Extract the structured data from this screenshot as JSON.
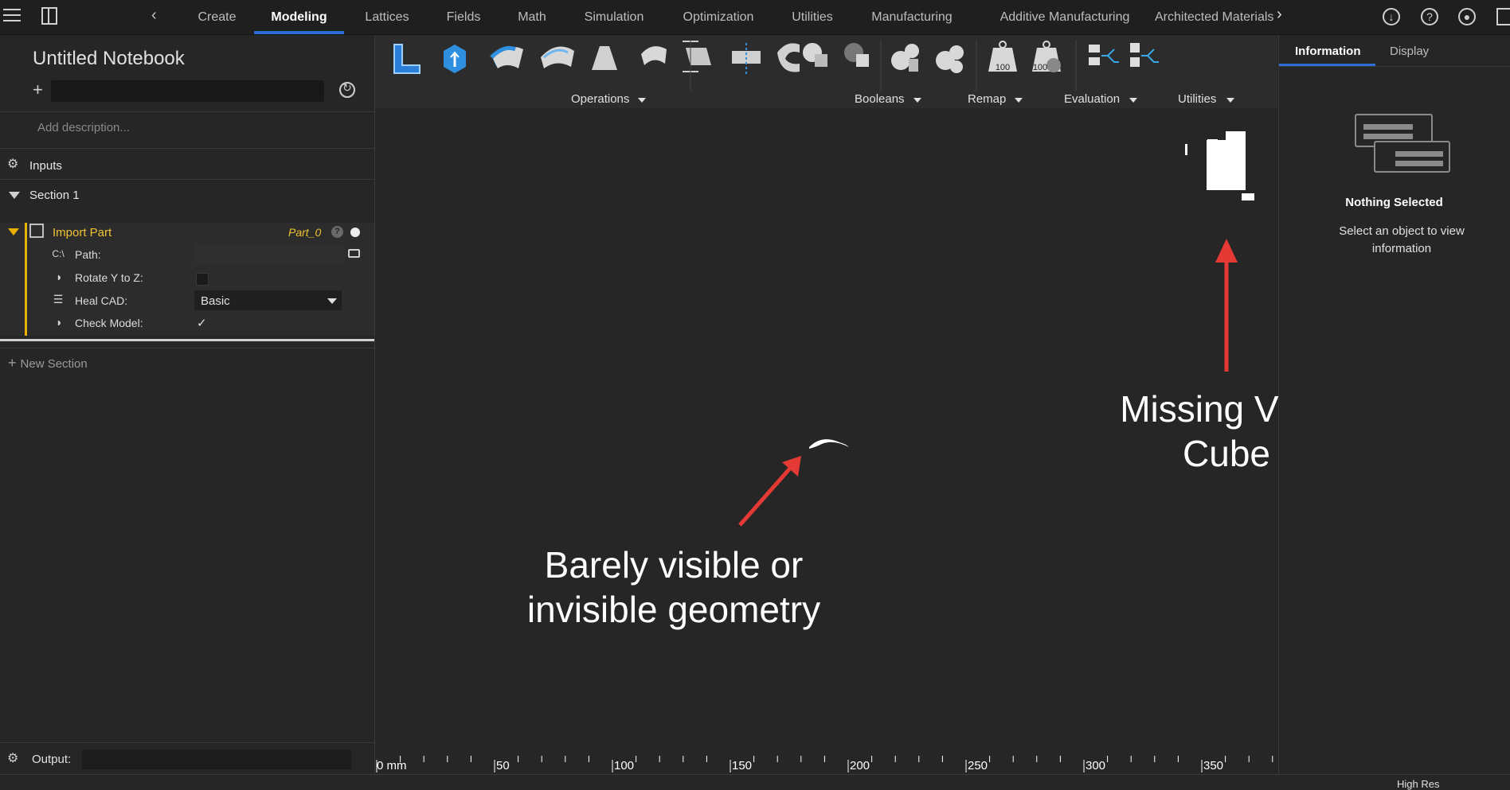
{
  "topbar": {
    "tabs": [
      "Create",
      "Modeling",
      "Lattices",
      "Fields",
      "Math",
      "Simulation",
      "Optimization",
      "Utilities",
      "Manufacturing",
      "Additive Manufacturing",
      "Architected Materials"
    ],
    "active_tab": "Modeling",
    "accent": "#2a6fd6"
  },
  "notebook": {
    "title": "Untitled Notebook",
    "description_placeholder": "Add description...",
    "inputs_label": "Inputs",
    "section_label": "Section 1",
    "new_section_label": "New Section",
    "output_label": "Output:"
  },
  "import_part": {
    "title": "Import Part",
    "part_name": "Part_0",
    "help": "?",
    "params": {
      "path_icon": "C:\\",
      "path_label": "Path:",
      "rotate_label": "Rotate Y to Z:",
      "heal_label": "Heal CAD:",
      "heal_value": "Basic",
      "check_label": "Check Model:",
      "check_value": "✓"
    },
    "accent": "#e8b000"
  },
  "ribbon": {
    "groups": [
      "Operations",
      "Booleans",
      "Remap",
      "Evaluation",
      "Utilities"
    ],
    "eval_value": "100",
    "eval_value2": "100"
  },
  "viewport": {
    "annotation_geometry": [
      "Barely visible or",
      "invisible geometry"
    ],
    "annotation_cube": [
      "Missing View",
      "Cube"
    ],
    "ruler_labels": [
      "0 mm",
      "50",
      "100",
      "150",
      "200",
      "250",
      "300",
      "350"
    ],
    "arrow_color": "#e53935"
  },
  "right_panel": {
    "tabs": [
      "Information",
      "Display"
    ],
    "heading": "Nothing Selected",
    "message": "Select an object to view information"
  },
  "footer": {
    "corner_label": "High Res"
  }
}
